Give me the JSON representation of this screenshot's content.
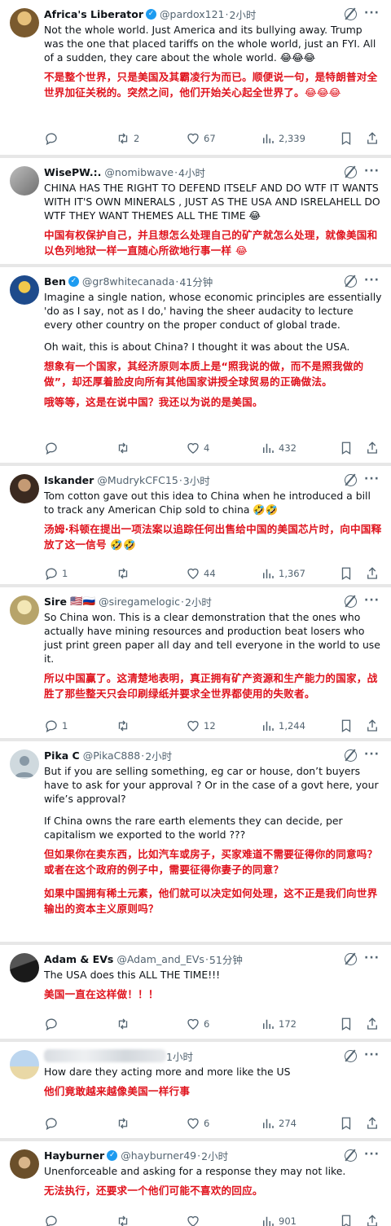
{
  "tweets": [
    {
      "name": "Africa's Liberator",
      "verified": true,
      "handle": "@pardox121",
      "time": "2小时",
      "text_en": "Not the whole world. Just America and its bullying away. Trump was the one that placed tariffs on the whole world, just an FYI. All of a sudden, they care about the whole world. 😂😂😂",
      "text_zh": "不是整个世界，只是美国及其霸凌行为而已。顺便说一句，是特朗普对全世界加征关税的。突然之间，他们开始关心起全世界了。😂😂😂",
      "replies": "",
      "reposts": "2",
      "likes": "67",
      "views": "2,339",
      "avatar_color": "#7a5a2e"
    },
    {
      "name": "WisePW.:.",
      "verified": false,
      "handle": "@nomibwave",
      "time": "4小时",
      "text_en": "CHINA HAS THE RIGHT TO DEFEND ITSELF AND DO WTF IT WANTS WITH IT'S OWN MINERALS , JUST AS THE USA AND ISRELAHELL DO WTF THEY WANT THEMES ALL THE TIME 😂",
      "text_zh": "中国有权保护自己，并且想怎么处理自己的矿产就怎么处理，就像美国和以色列地狱一样一直随心所欲地行事一样 😂",
      "replies": "",
      "reposts": "",
      "likes": "",
      "views": "",
      "avatar_color": "#8c8c8c"
    },
    {
      "name": "Ben",
      "verified": true,
      "handle": "@gr8whitecanada",
      "time": "41分钟",
      "text_en": "Imagine a single nation, whose economic principles are essentially 'do as I say, not as I do,' having the sheer audacity to lecture every other country on the proper conduct of global trade.",
      "text_en2": "Oh wait, this is about China? I thought it was about the USA.",
      "text_zh": "想象有一个国家，其经济原则本质上是“照我说的做，而不是照我做的做”，却还厚着脸皮向所有其他国家讲授全球贸易的正确做法。",
      "text_zh2": "哦等等，这是在说中国？我还以为说的是美国。",
      "replies": "",
      "reposts": "",
      "likes": "4",
      "views": "432",
      "avatar_color": "#1e4b8c"
    },
    {
      "name": "Iskander",
      "verified": false,
      "handle": "@MudrykCFC15",
      "time": "3小时",
      "text_en": "Tom cotton gave out this idea to China when he introduced a bill to track any American Chip sold to china 🤣🤣",
      "text_zh": "汤姆·科顿在提出一项法案以追踪任何出售给中国的美国芯片时，向中国释放了这一信号 🤣🤣",
      "replies": "1",
      "reposts": "",
      "likes": "44",
      "views": "1,367",
      "avatar_color": "#5b3a29"
    },
    {
      "name": "Sire",
      "verified": false,
      "flags": "🇺🇸🇷🇺",
      "handle": "@siregamelogic",
      "time": "2小时",
      "text_en": "So China won. This is a clear demonstration that the ones who actually have mining resources and production beat losers who just print green paper all day and tell everyone in the world to use it.",
      "text_zh": "所以中国赢了。这清楚地表明，真正拥有矿产资源和生产能力的国家，战胜了那些整天只会印刷绿纸并要求全世界都使用的失败者。",
      "replies": "1",
      "reposts": "",
      "likes": "12",
      "views": "1,244",
      "avatar_color": "#c9b98a"
    },
    {
      "name": "Pika C",
      "verified": false,
      "handle": "@PikaC888",
      "time": "2小时",
      "text_en": "But if you are selling something, eg car or house, don’t buyers have to ask for your approval ? Or in the case of a govt here, your wife’s approval?",
      "text_en2": "If China owns the rare earth elements they can decide, per capitalism we exported to the world ???",
      "text_zh": "但如果你在卖东西，比如汽车或房子，买家难道不需要征得你的同意吗？或者在这个政府的例子中，需要征得你妻子的同意？",
      "text_zh2": "如果中国拥有稀土元素，他们就可以决定如何处理，这不正是我们向世界输出的资本主义原则吗？",
      "replies": "",
      "reposts": "",
      "likes": "",
      "views": "",
      "avatar_color": "#b8c2cc"
    },
    {
      "name": "Adam & EVs",
      "verified": false,
      "handle": "@Adam_and_EVs",
      "time": "51分钟",
      "text_en": "The USA does this ALL THE TIME!!!",
      "text_zh": "美国一直在这样做！！！",
      "replies": "",
      "reposts": "",
      "likes": "6",
      "views": "172",
      "avatar_color": "#2b2b2b"
    },
    {
      "name": "",
      "verified": false,
      "handle": "",
      "time": "1小时",
      "text_en": "How dare they acting more and more like the US",
      "text_zh": "他们竟敢越来越像美国一样行事",
      "replies": "",
      "reposts": "",
      "likes": "6",
      "views": "274",
      "avatar_color": "#7fa7c9"
    },
    {
      "name": "Hayburner",
      "verified": true,
      "handle": "@hayburner49",
      "time": "2小时",
      "text_en": "Unenforceable and asking for a response they may not like.",
      "text_zh": "无法执行，还要求一个他们可能不喜欢的回应。",
      "replies": "",
      "reposts": "",
      "likes": "",
      "views": "901",
      "avatar_color": "#6b4f2a"
    }
  ]
}
